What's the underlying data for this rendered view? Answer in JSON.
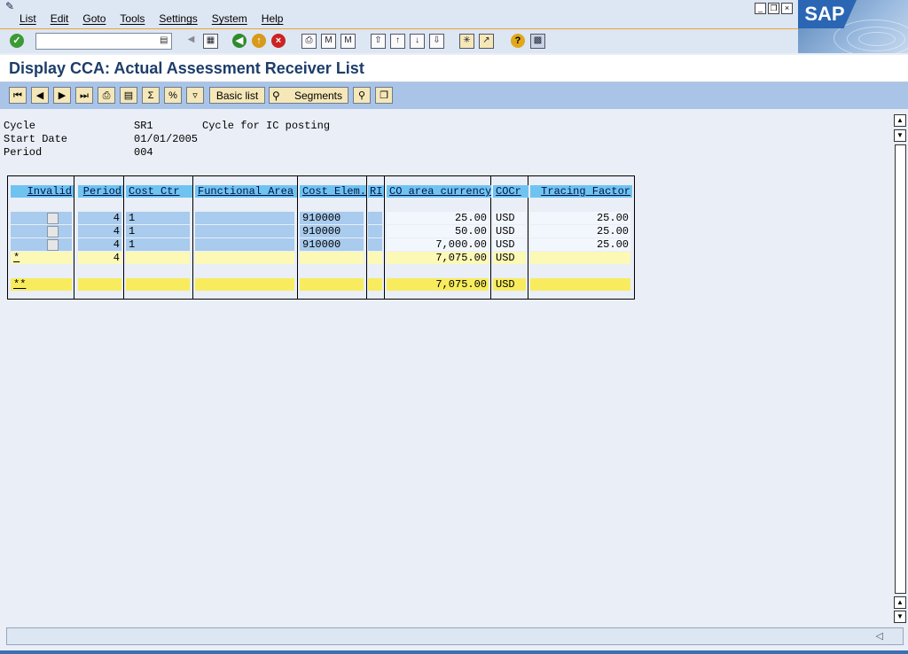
{
  "menu": [
    "List",
    "Edit",
    "Goto",
    "Tools",
    "Settings",
    "System",
    "Help"
  ],
  "brand": "SAP",
  "command_field": {
    "value": ""
  },
  "page_title": "Display CCA: Actual Assessment Receiver List",
  "app_toolbar": {
    "basic_list": "Basic list",
    "segments": "Segments"
  },
  "header_info": {
    "cycle_label": "Cycle",
    "cycle_value": "SR1",
    "cycle_text": "Cycle for IC posting",
    "start_label": "Start Date",
    "start_value": "01/01/2005",
    "period_label": "Period",
    "period_value": "004"
  },
  "table": {
    "columns": [
      "Invalid",
      "Period",
      "Cost Ctr",
      "Functional Area",
      "Cost Elem.",
      "RI",
      "CO area currency",
      "COCr",
      "Tracing Factor"
    ],
    "rows": [
      {
        "period": "4",
        "cost_ctr": "1",
        "cost_elem": "910000",
        "amount": "25.00",
        "cocr": "USD",
        "tracing": "25.00"
      },
      {
        "period": "4",
        "cost_ctr": "1",
        "cost_elem": "910000",
        "amount": "50.00",
        "cocr": "USD",
        "tracing": "25.00"
      },
      {
        "period": "4",
        "cost_ctr": "1",
        "cost_elem": "910000",
        "amount": "7,000.00",
        "cocr": "USD",
        "tracing": "25.00"
      }
    ],
    "subtotal": {
      "marker": "*",
      "period": "4",
      "amount": "7,075.00",
      "cocr": "USD"
    },
    "total": {
      "marker": "**",
      "amount": "7,075.00",
      "cocr": "USD"
    }
  },
  "colors": {
    "header_cell": "#6fc3f0",
    "key_cell": "#a8cbee",
    "subtotal": "#fcf8b6",
    "total": "#f8ec5e",
    "app_toolbar": "#a9c4e6"
  }
}
